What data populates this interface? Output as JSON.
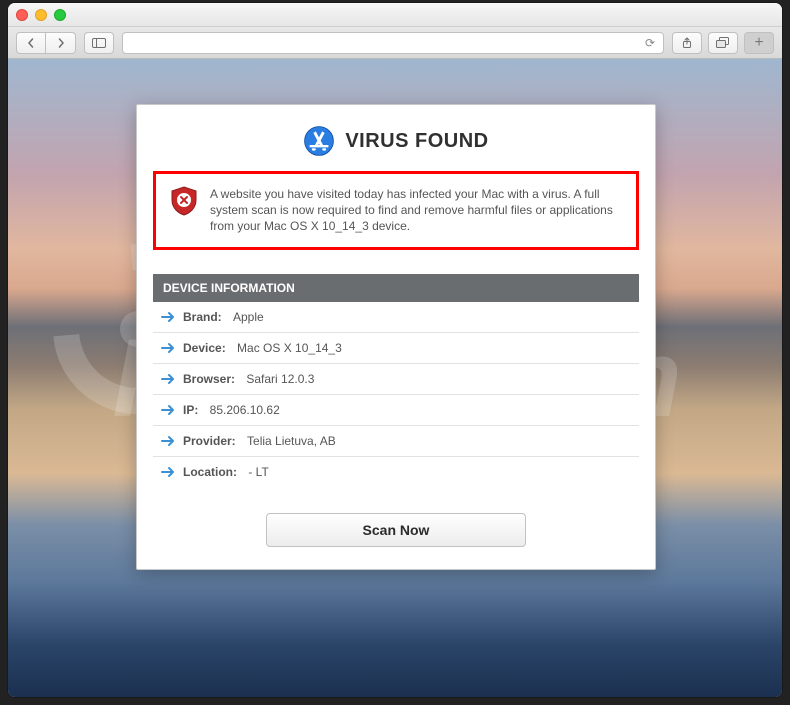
{
  "popup": {
    "title": "VIRUS FOUND",
    "alert_text": "A website you have visited today has infected your Mac with a virus. A full system scan is now required to find and remove harmful files or applications from your Mac OS X 10_14_3 device.",
    "device_header": "DEVICE INFORMATION",
    "scan_label": "Scan Now",
    "rows": [
      {
        "label": "Brand: ",
        "value": "Apple"
      },
      {
        "label": "Device: ",
        "value": "Mac OS X 10_14_3"
      },
      {
        "label": "Browser: ",
        "value": "Safari 12.0.3"
      },
      {
        "label": "IP: ",
        "value": "85.206.10.62"
      },
      {
        "label": "Provider: ",
        "value": "Telia Lietuva, AB"
      },
      {
        "label": "Location: ",
        "value": "- LT"
      }
    ]
  },
  "browser": {
    "reload_glyph": "⟳",
    "share_glyph": "⇪",
    "tabs_glyph": "⧉",
    "plus_glyph": "+",
    "sidebar_glyph": "▭"
  }
}
